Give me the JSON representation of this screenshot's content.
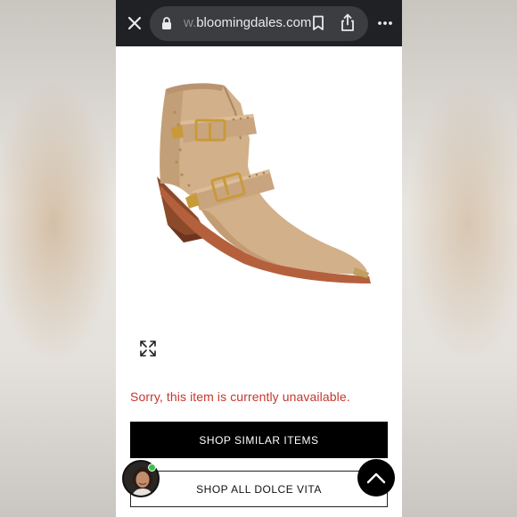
{
  "browser": {
    "url_faded": "w.",
    "url_main": "bloomingdales.com",
    "close_icon": "close-icon",
    "lock_icon": "lock-icon",
    "bookmark_icon": "bookmark-icon",
    "share_icon": "share-icon",
    "more_icon": "more-dots-icon"
  },
  "product": {
    "image_icon": "boot-image",
    "expand_icon": "expand-icon",
    "unavailable_text": "Sorry, this item is currently unavailable."
  },
  "actions": {
    "similar_label": "SHOP SIMILAR ITEMS",
    "brand_label": "SHOP ALL DOLCE VITA"
  },
  "overlay": {
    "avatar_icon": "avatar",
    "scroll_top_icon": "chevron-up-icon"
  },
  "colors": {
    "topbar": "#202124",
    "url_pill": "#3c3d41",
    "error_text": "#c4372e",
    "primary_button": "#000000",
    "online": "#3cc04a"
  }
}
